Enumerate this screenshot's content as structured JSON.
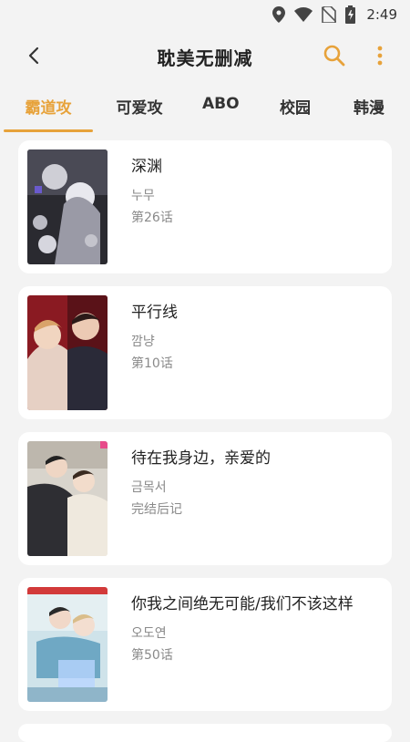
{
  "status_bar": {
    "time": "2:49",
    "icons": [
      "location-icon",
      "wifi-icon",
      "no-sim-icon",
      "battery-charging-icon"
    ]
  },
  "app_bar": {
    "title": "耽美无删减",
    "back_icon": "back-arrow-icon",
    "search_icon": "search-icon",
    "more_icon": "more-vert-icon",
    "accent_color": "#e7a23a"
  },
  "tabs": [
    {
      "label": "霸道攻",
      "active": true
    },
    {
      "label": "可爱攻",
      "active": false
    },
    {
      "label": "ABO",
      "active": false
    },
    {
      "label": "校园",
      "active": false
    },
    {
      "label": "韩漫",
      "active": false
    }
  ],
  "comics": [
    {
      "title": "深渊",
      "author": "누무",
      "chapter": "第26话"
    },
    {
      "title": "平行线",
      "author": "깜냥",
      "chapter": "第10话"
    },
    {
      "title": "待在我身边，亲爱的",
      "author": "금목서",
      "chapter": "完结后记"
    },
    {
      "title": "你我之间绝无可能/我们不该这样",
      "author": "오도연",
      "chapter": "第50话"
    }
  ]
}
